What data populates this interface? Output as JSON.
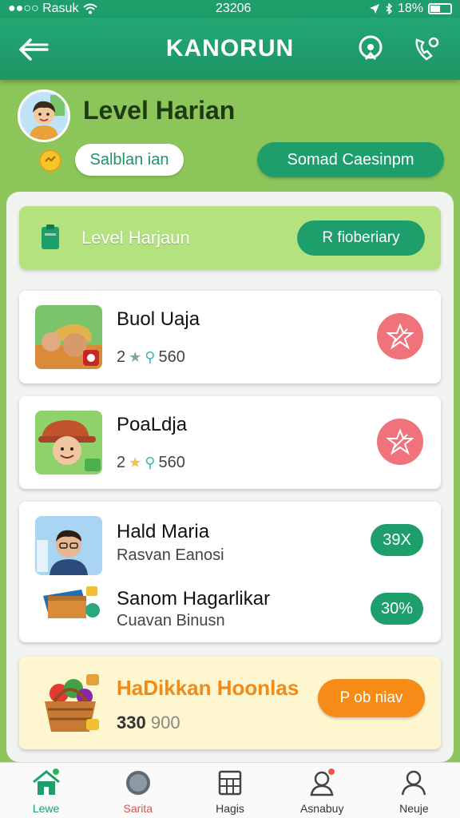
{
  "status": {
    "carrier": "●●○○ Rasuk",
    "time": "23206",
    "battery": "18%"
  },
  "header": {
    "title": "KANORUN",
    "back_icon": "back-arrow-icon",
    "search_icon": "search-icon",
    "call_icon": "phone-icon"
  },
  "profile": {
    "title": "Level Harian",
    "chip_label": "Salblan ian",
    "action_label": "Somad Caesinpm"
  },
  "banner": {
    "label": "Level  Harjaun",
    "button_label": "R fioberiary"
  },
  "cards": [
    {
      "title": "Buol Uaja",
      "count": "2",
      "score": "560"
    },
    {
      "title": "PoaLdja",
      "count": "2",
      "score": "560"
    }
  ],
  "list_card": {
    "items": [
      {
        "title": "Hald Maria",
        "subtitle": "Rasvan Eanosi",
        "badge": "39X"
      },
      {
        "title": "Sanom Hagarlikar",
        "subtitle": "Cuavan Binusn",
        "badge": "30%"
      }
    ]
  },
  "reward": {
    "title": "HaDikkan Hoonlas",
    "value": "330",
    "value_muted": "900",
    "button_label": "P ob niav"
  },
  "nav": [
    {
      "label": "Lewe",
      "icon": "home-icon"
    },
    {
      "label": "Sarita",
      "icon": "compass-icon"
    },
    {
      "label": "Hagis",
      "icon": "grid-icon"
    },
    {
      "label": "Asnabuy",
      "icon": "user-alert-icon"
    },
    {
      "label": "Neuje",
      "icon": "profile-icon"
    }
  ],
  "colors": {
    "brand_green": "#1e9e6a",
    "background_green": "#8cc65a",
    "accent_orange": "#f78b18",
    "alert_red": "#f0727a"
  }
}
